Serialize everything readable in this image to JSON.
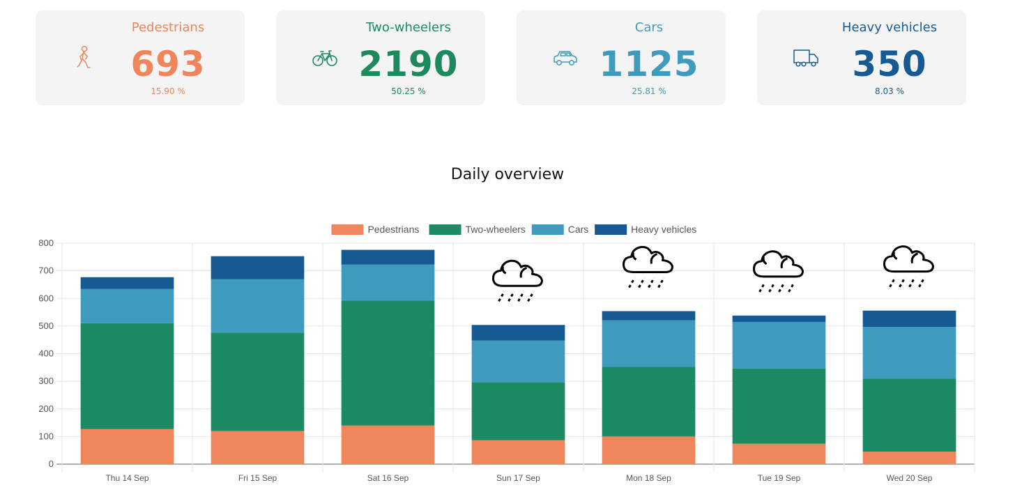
{
  "cards": [
    {
      "title": "Pedestrians",
      "value": "693",
      "percent": "15.90 %",
      "color": "#f0845a",
      "icon": "pedestrian-icon"
    },
    {
      "title": "Two-wheelers",
      "value": "2190",
      "percent": "50.25 %",
      "color": "#1c8a5e",
      "icon": "bicycle-icon"
    },
    {
      "title": "Cars",
      "value": "1125",
      "percent": "25.81 %",
      "color": "#3e9bbc",
      "icon": "car-icon"
    },
    {
      "title": "Heavy vehicles",
      "value": "350",
      "percent": "8.03 %",
      "color": "#155a92",
      "icon": "truck-icon"
    }
  ],
  "section_title": "Daily overview",
  "chart_data": {
    "type": "bar",
    "stacked": true,
    "title": "Daily overview",
    "xlabel": "",
    "ylabel": "",
    "ylim": [
      0,
      800
    ],
    "yticks": [
      0,
      100,
      200,
      300,
      400,
      500,
      600,
      700,
      800
    ],
    "grid": true,
    "legend_position": "top",
    "categories": [
      "Thu 14 Sep",
      "Fri 15 Sep",
      "Sat 16 Sep",
      "Sun 17 Sep",
      "Mon 18 Sep",
      "Tue 19 Sep",
      "Wed 20 Sep"
    ],
    "series": [
      {
        "name": "Pedestrians",
        "color": "#f0845a",
        "values": [
          127,
          120,
          140,
          87,
          100,
          74,
          45
        ]
      },
      {
        "name": "Two-wheelers",
        "color": "#1c8a62",
        "values": [
          383,
          356,
          452,
          210,
          252,
          272,
          265
        ]
      },
      {
        "name": "Cars",
        "color": "#3e9bbd",
        "values": [
          124,
          194,
          131,
          151,
          169,
          169,
          187
        ]
      },
      {
        "name": "Heavy vehicles",
        "color": "#155a92",
        "values": [
          43,
          83,
          53,
          56,
          33,
          23,
          59
        ]
      }
    ],
    "annotations": [
      {
        "category": "Sun 17 Sep",
        "icon": "rain-cloud-icon"
      },
      {
        "category": "Mon 18 Sep",
        "icon": "rain-cloud-icon"
      },
      {
        "category": "Tue 19 Sep",
        "icon": "rain-cloud-icon"
      },
      {
        "category": "Wed 20 Sep",
        "icon": "rain-cloud-icon"
      }
    ]
  }
}
